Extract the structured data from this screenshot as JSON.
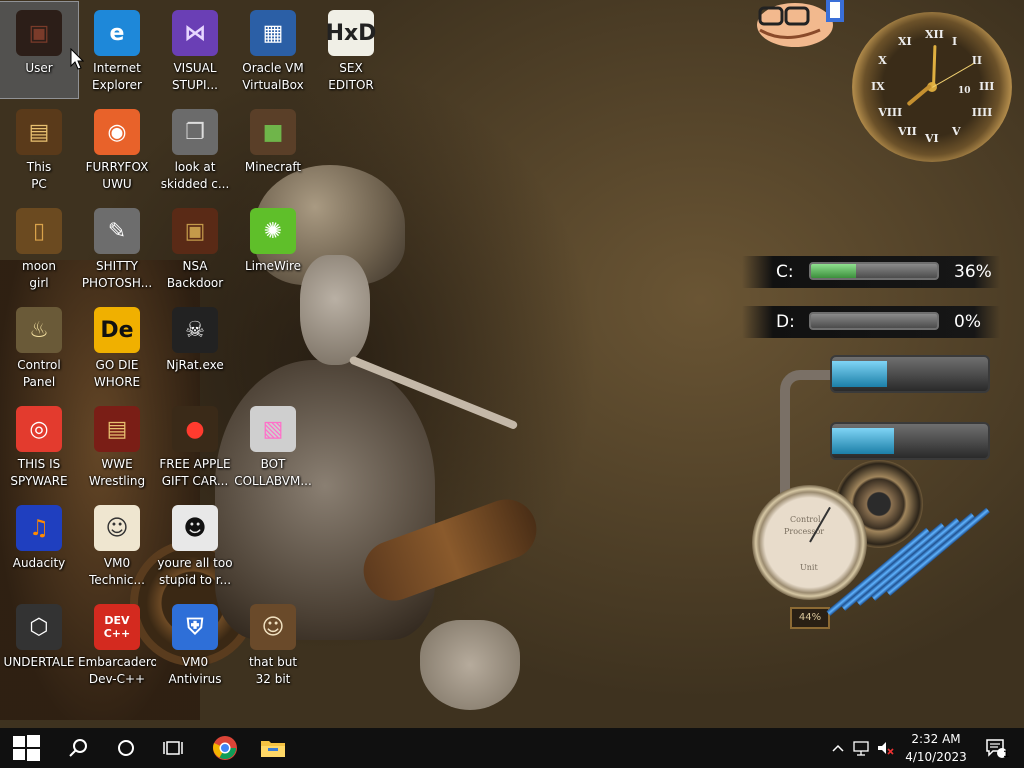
{
  "desktop": {
    "icons": [
      {
        "label": "User",
        "glyph": "▣",
        "color": "#7a3b2a",
        "bg": "#2c1e18"
      },
      {
        "label": "Internet Explorer",
        "glyph": "e",
        "color": "#ffffff",
        "bg": "#1e88d9"
      },
      {
        "label": "VISUAL STUPI...",
        "glyph": "⋈",
        "color": "#e6d6ff",
        "bg": "#6a3fb5"
      },
      {
        "label": "Oracle VM VirtualBox",
        "glyph": "▦",
        "color": "#ffffff",
        "bg": "#2b5fa6"
      },
      {
        "label": "SEX EDITOR",
        "glyph": "HxD",
        "color": "#222222",
        "bg": "#f0efe6"
      },
      {
        "label": "This PC",
        "glyph": "▤",
        "color": "#e8c070",
        "bg": "#5a3a1a"
      },
      {
        "label": "FURRYFOX UWU",
        "glyph": "◉",
        "color": "#ffffff",
        "bg": "#e8622a"
      },
      {
        "label": "look at skidded c...",
        "glyph": "❐",
        "color": "#dddddd",
        "bg": "#6b6b6b"
      },
      {
        "label": "Minecraft",
        "glyph": "■",
        "color": "#6fb54a",
        "bg": "#5a3f28"
      },
      {
        "label": "moon girl",
        "glyph": "▯",
        "color": "#d9a24a",
        "bg": "#6b4a20"
      },
      {
        "label": "SHITTY PHOTOSH...",
        "glyph": "✎",
        "color": "#ffffff",
        "bg": "#6d6d6d"
      },
      {
        "label": "NSA Backdoor",
        "glyph": "▣",
        "color": "#c49a4a",
        "bg": "#5a2a16"
      },
      {
        "label": "LimeWire",
        "glyph": "✺",
        "color": "#ffffff",
        "bg": "#5fbf2a"
      },
      {
        "label": "Control Panel",
        "glyph": "♨",
        "color": "#f5e1a0",
        "bg": "#6a5a38"
      },
      {
        "label": "GO DIE WHORE",
        "glyph": "De",
        "color": "#111111",
        "bg": "#f0b000"
      },
      {
        "label": "NjRat.exe",
        "glyph": "☠",
        "color": "#ffffff",
        "bg": "#222222"
      },
      {
        "label": "THIS IS SPYWARE",
        "glyph": "◎",
        "color": "#ffffff",
        "bg": "#e33b2e"
      },
      {
        "label": "WWE Wrestling",
        "glyph": "▤",
        "color": "#e8c070",
        "bg": "#7a1e16"
      },
      {
        "label": "FREE APPLE GIFT CAR...",
        "glyph": "●",
        "color": "#ff3b2e",
        "bg": "#3a2a18"
      },
      {
        "label": "BOT COLLABVM...",
        "glyph": "▧",
        "color": "#ff6fc9",
        "bg": "#cfcfcf"
      },
      {
        "label": "Audacity",
        "glyph": "♫",
        "color": "#ff8a00",
        "bg": "#1f3fbf"
      },
      {
        "label": "VM0 Technic...",
        "glyph": "☺",
        "color": "#333333",
        "bg": "#efe6d0"
      },
      {
        "label": "youre all too stupid to r...",
        "glyph": "☻",
        "color": "#111111",
        "bg": "#e8e8e8"
      },
      {
        "label": "UNDERTALE",
        "glyph": "⬡",
        "color": "#ffffff",
        "bg": "#333333"
      },
      {
        "label": "Embarcadero Dev-C++",
        "glyph": "DEV C++",
        "color": "#ffffff",
        "bg": "#d42a1f"
      },
      {
        "label": "VM0 Antivirus",
        "glyph": "⛨",
        "color": "#ffffff",
        "bg": "#2e6fd8"
      },
      {
        "label": "that but 32 bit",
        "glyph": "☺",
        "color": "#f0e0c0",
        "bg": "#6a4a2a"
      }
    ]
  },
  "widgets": {
    "clock": {
      "numerals": [
        "XII",
        "I",
        "II",
        "III",
        "IIII",
        "V",
        "VI",
        "VII",
        "VIII",
        "IX",
        "X",
        "XI"
      ],
      "inner_label": "10"
    },
    "drives": [
      {
        "label": "C:",
        "percent_text": "36%",
        "fill": 0.36
      },
      {
        "label": "D:",
        "percent_text": "0%",
        "fill": 0.0
      }
    ],
    "pipes": {
      "tube_levels": [
        0.35,
        0.4
      ],
      "gauge_label_top": "Control",
      "gauge_label_mid": "Processor",
      "gauge_label_bottom": "Unit",
      "gauge_value": "44%"
    }
  },
  "taskbar": {
    "start_icon": "windows-logo",
    "search_icon": "search-icon",
    "cortana_icon": "circle-icon",
    "taskview_icon": "task-view-icon",
    "pinned": [
      {
        "name": "chrome",
        "glyph": "◎"
      },
      {
        "name": "file-explorer",
        "glyph": "▬"
      }
    ],
    "tray": {
      "time": "2:32 AM",
      "date": "4/10/2023",
      "notification_count": "1"
    }
  },
  "colors": {
    "taskbar_bg": "#101010",
    "selection": "#8c8caa"
  }
}
